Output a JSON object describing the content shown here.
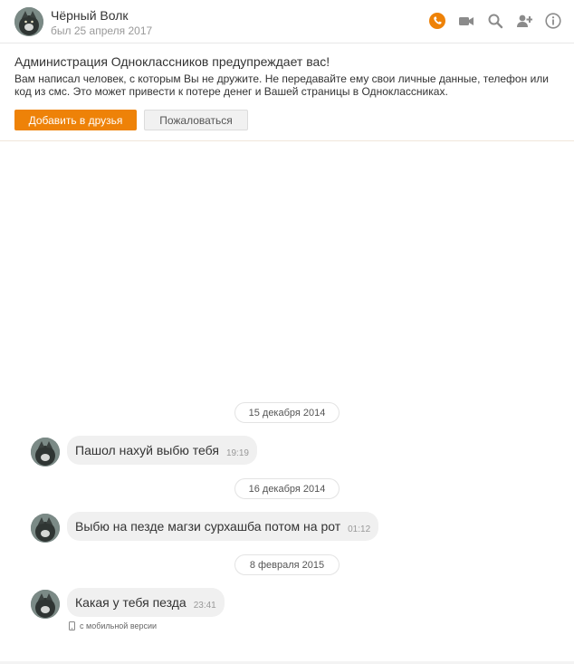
{
  "header": {
    "name": "Чёрный Волк",
    "status": "был 25 апреля 2017",
    "actions": [
      {
        "icon": "phone-icon",
        "color": "#ee8208"
      },
      {
        "icon": "video-camera-icon",
        "color": "#8b8b8b"
      },
      {
        "icon": "search-icon",
        "color": "#8b8b8b"
      },
      {
        "icon": "add-user-icon",
        "color": "#8b8b8b"
      },
      {
        "icon": "info-icon",
        "color": "#8b8b8b"
      }
    ]
  },
  "warning": {
    "title": "Администрация Одноклассников предупреждает вас!",
    "text": "Вам написал человек, с которым Вы не дружите. Не передавайте ему свои личные данные, телефон или код из смс. Это может привести к потере денег и Вашей страницы в Одноклассниках.",
    "add_friend_label": "Добавить в друзья",
    "complain_label": "Пожаловаться"
  },
  "messages": [
    {
      "date": "15 декабря 2014",
      "text": "Пашол нахуй выбю тебя",
      "time": "19:19"
    },
    {
      "date": "16 декабря 2014",
      "text": "Выбю на пезде магзи сурхашба потом на рот",
      "time": "01:12"
    },
    {
      "date": "8 февраля 2015",
      "text": "Какая у тебя пезда",
      "time": "23:41"
    }
  ],
  "mobile_note": "с мобильной версии",
  "colors": {
    "accent": "#ee8208",
    "bubble": "#f0f0f0"
  }
}
